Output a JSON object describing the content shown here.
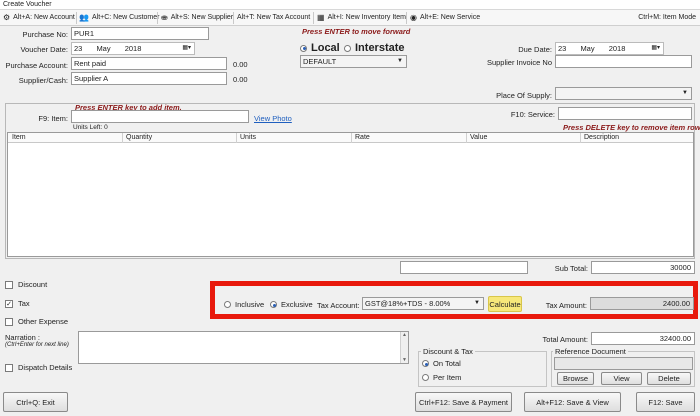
{
  "window": {
    "title": "Create Voucher"
  },
  "toolbar": {
    "items": [
      {
        "label": "Alt+A: New Account",
        "icon": "add-account-icon"
      },
      {
        "label": "Alt+C: New Customer",
        "icon": "customer-icon"
      },
      {
        "label": "Alt+S: New Supplier",
        "icon": "supplier-icon"
      },
      {
        "label": "Alt+T: New Tax Account",
        "icon": ""
      },
      {
        "label": "Alt+I: New Inventory Item",
        "icon": "inventory-icon"
      },
      {
        "label": "Alt+E: New Service",
        "icon": "service-icon"
      }
    ],
    "item_mode": "Ctrl+M: Item Mode"
  },
  "form": {
    "purchase_no_label": "Purchase No:",
    "purchase_no": "PUR1",
    "voucher_date_label": "Voucher Date:",
    "voucher_date": {
      "day": "23",
      "month": "May",
      "year": "2018"
    },
    "purchase_account_label": "Purchase Account:",
    "purchase_account": "Rent paid",
    "purchase_account_balance": "0.00",
    "supplier_label": "Supplier/Cash:",
    "supplier": "Supplier A",
    "supplier_balance": "0.00",
    "enter_note": "Press ENTER to move forward",
    "local_label": "Local",
    "interstate_label": "Interstate",
    "tax_mode_selected": "local",
    "tax_profile": "DEFAULT",
    "due_date_label": "Due Date:",
    "due_date": {
      "day": "23",
      "month": "May",
      "year": "2018"
    },
    "supplier_invoice_label": "Supplier Invoice No",
    "supplier_invoice": "",
    "place_of_supply_label": "Place Of Supply:",
    "place_of_supply": ""
  },
  "items": {
    "add_note": "Press ENTER key to add item.",
    "item_label": "F9: Item:",
    "item_value": "",
    "view_photo": "View Photo",
    "units_left": "Units Left: 0",
    "service_label": "F10: Service:",
    "service_value": "",
    "remove_note": "Press DELETE key to remove item row.",
    "columns": [
      "Item",
      "Quantity",
      "Units",
      "Rate",
      "Value",
      "Description"
    ]
  },
  "totals": {
    "subtotal_label": "Sub Total:",
    "subtotal": "30000",
    "discount_label": "Discount",
    "discount_checked": false,
    "tax_label": "Tax",
    "tax_checked": true,
    "other_expense_label": "Other Expense",
    "other_expense_checked": false,
    "inclusive_label": "Inclusive",
    "exclusive_label": "Exclusive",
    "tax_type_selected": "exclusive",
    "tax_account_label": "Tax Account:",
    "tax_account": "GST@18%+TDS - 8.00%",
    "calculate_label": "Calculate",
    "tax_amount_label": "Tax Amount:",
    "tax_amount": "2400.00",
    "total_amount_label": "Total Amount:",
    "total_amount": "32400.00"
  },
  "narration": {
    "label": "Narration :",
    "hint": "(Ctrl+Enter for next line)",
    "value": ""
  },
  "dispatch": {
    "label": "Dispatch Details",
    "checked": false
  },
  "discount_tax": {
    "title": "Discount & Tax",
    "on_total": "On Total",
    "per_item": "Per Item",
    "selected": "on_total"
  },
  "reference": {
    "title": "Reference Document",
    "value": "",
    "browse": "Browse",
    "view": "View",
    "delete": "Delete"
  },
  "footer": {
    "exit": "Ctrl+Q: Exit",
    "save_payment": "Ctrl+F12: Save & Payment",
    "save_view": "Alt+F12: Save & View",
    "save": "F12: Save"
  },
  "colors": {
    "highlight_border": "#e8190c",
    "calculate_bg": "#f7e87a",
    "note_red": "#8b1a1a"
  }
}
